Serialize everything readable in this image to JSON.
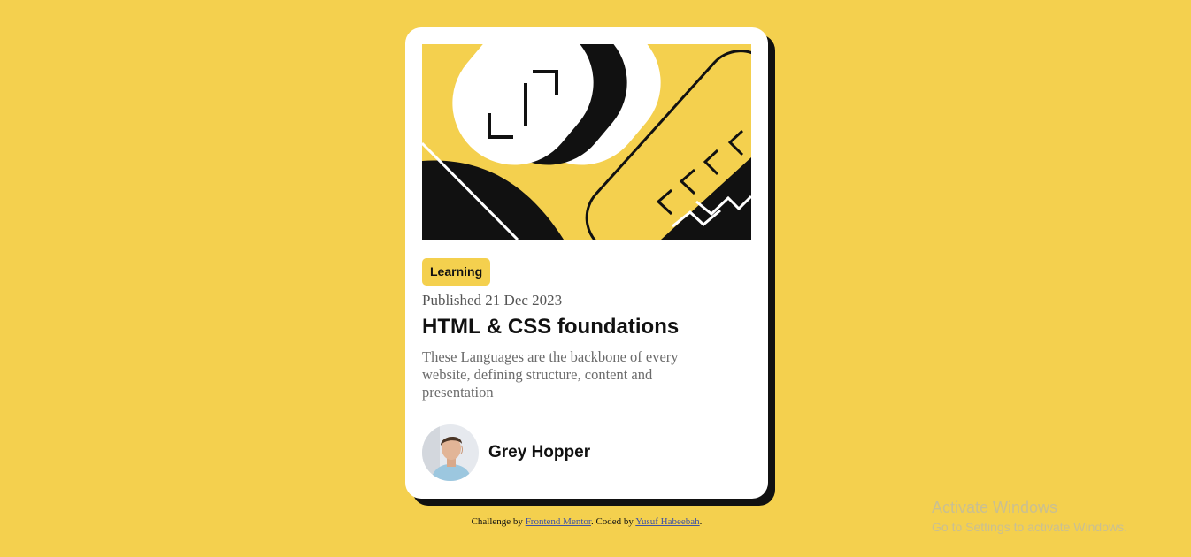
{
  "card": {
    "tag": "Learning",
    "published": "Published 21 Dec 2023",
    "title": "HTML & CSS foundations",
    "description": "These Languages are the backbone of every website, defining structure, content and presentation",
    "author": "Grey Hopper"
  },
  "attribution": {
    "prefix": "Challenge by",
    "link1": "Frontend Mentor",
    "middle": ". Coded by",
    "link2": "Yusuf Habeebah",
    "suffix": "."
  },
  "watermark": {
    "title": "Activate Windows",
    "subtitle": "Go to Settings to activate Windows."
  },
  "colors": {
    "background": "#f4d04e",
    "card": "#ffffff",
    "shadow": "#111111",
    "link": "#3e52a3"
  },
  "icons": [
    "hero-illustration",
    "author-avatar"
  ]
}
